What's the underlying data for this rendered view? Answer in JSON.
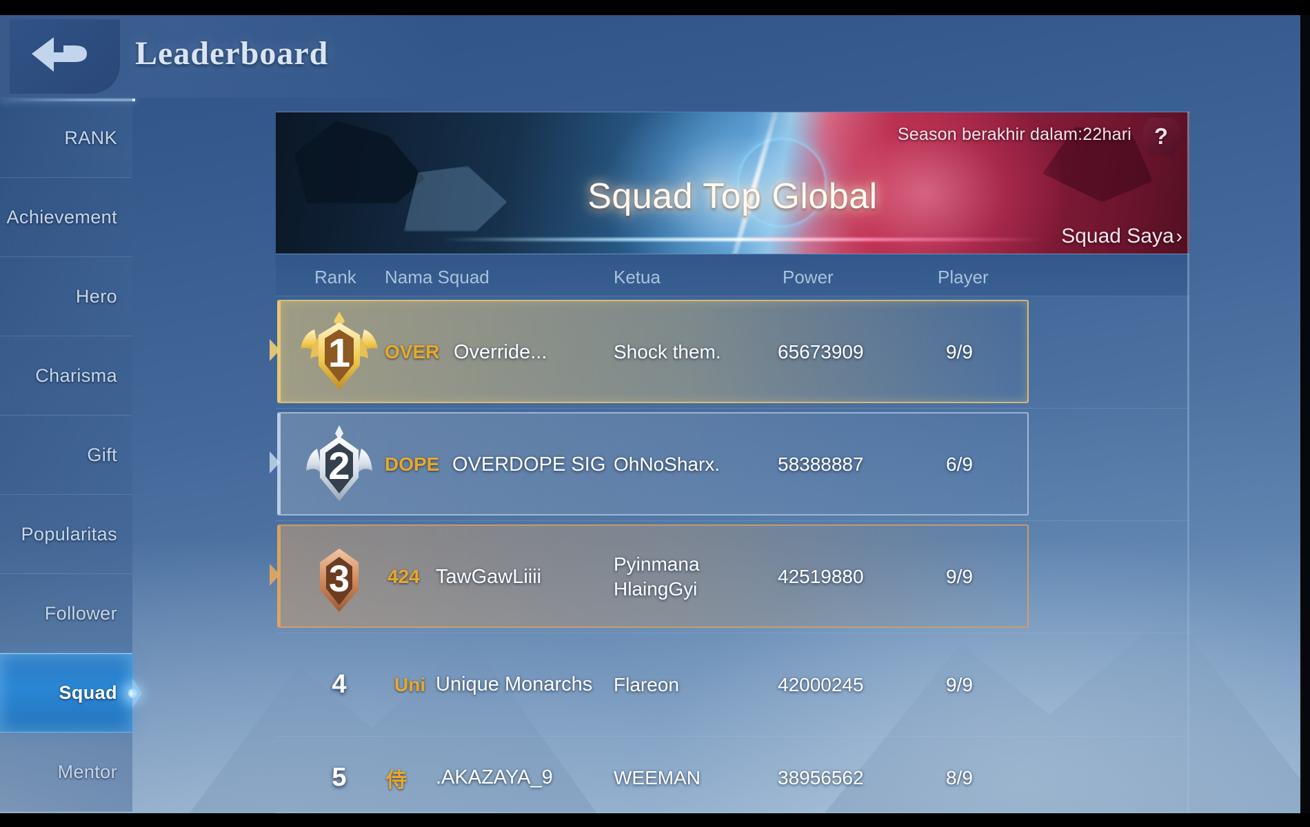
{
  "header": {
    "title": "Leaderboard",
    "back_icon": "back-arrow-icon"
  },
  "sidebar": {
    "items": [
      {
        "label": "RANK",
        "active": false
      },
      {
        "label": "Achievement",
        "active": false
      },
      {
        "label": "Hero",
        "active": false
      },
      {
        "label": "Charisma",
        "active": false
      },
      {
        "label": "Gift",
        "active": false
      },
      {
        "label": "Popularitas",
        "active": false
      },
      {
        "label": "Follower",
        "active": false
      },
      {
        "label": "Squad",
        "active": true
      },
      {
        "label": "Mentor",
        "active": false
      }
    ]
  },
  "banner": {
    "title": "Squad Top Global",
    "season_text": "Season berakhir dalam:22hari",
    "help_label": "?",
    "my_squad_label": "Squad Saya",
    "my_squad_chevron": "›"
  },
  "table": {
    "headers": {
      "rank": "Rank",
      "name": "Nama Squad",
      "leader": "Ketua",
      "power": "Power",
      "player": "Player"
    },
    "rows": [
      {
        "rank": "1",
        "badge": "gold-rank-badge",
        "tag": "OVER",
        "name": "Override...",
        "leader": "Shock them.",
        "power": "65673909",
        "players": "9/9"
      },
      {
        "rank": "2",
        "badge": "silver-rank-badge",
        "tag": "DOPE",
        "name": "OVERDOPE SIG",
        "leader": "OhNoSharx.",
        "power": "58388887",
        "players": "6/9"
      },
      {
        "rank": "3",
        "badge": "bronze-rank-badge",
        "tag": "424",
        "name": "TawGawLiiii",
        "leader": "Pyinmana HlaingGyi",
        "power": "42519880",
        "players": "9/9"
      },
      {
        "rank": "4",
        "badge": "none",
        "tag": "Uni",
        "name": "Unique Monarchs",
        "leader": "Flareon",
        "power": "42000245",
        "players": "9/9"
      },
      {
        "rank": "5",
        "badge": "none",
        "tag": "侍",
        "name": ".AKAZAYA_9",
        "leader": "WEEMAN",
        "power": "38956562",
        "players": "8/9"
      }
    ]
  },
  "colors": {
    "accent_gold": "#e8a828",
    "active_nav": "#2a86d4",
    "rank1_border": "#e5c476",
    "rank3_border": "#daa062"
  }
}
